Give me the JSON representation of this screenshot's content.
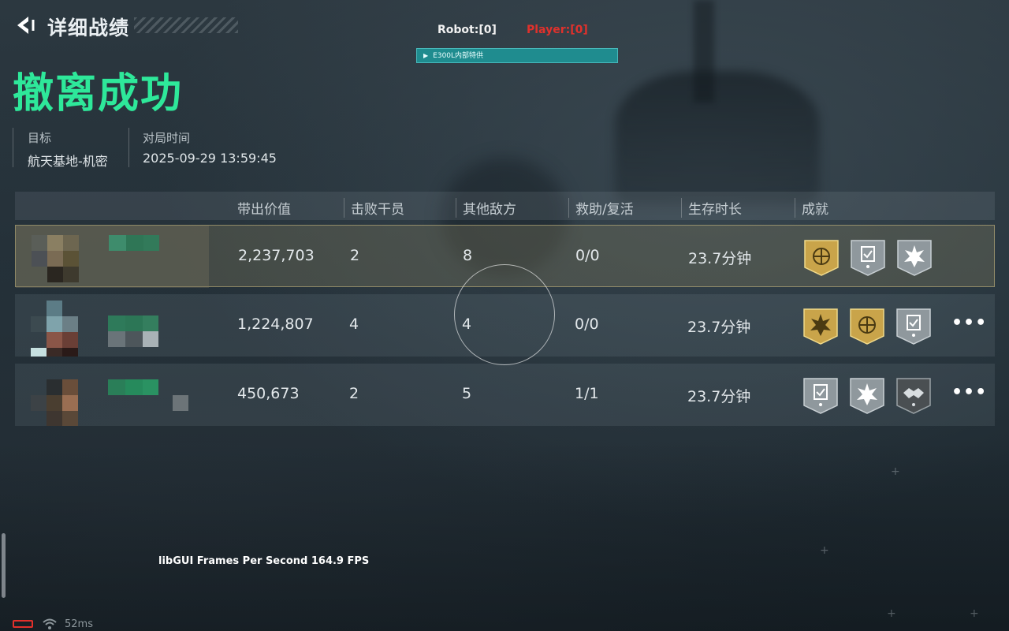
{
  "header": {
    "title": "详细战绩"
  },
  "hud": {
    "robot": "Robot:[0]",
    "player": "Player:[0]",
    "banner": "E300L内部特供"
  },
  "result": "撤离成功",
  "info": {
    "target_label": "目标",
    "target_value": "航天基地-机密",
    "time_label": "对局时间",
    "time_value": "2025-09-29 13:59:45"
  },
  "table": {
    "headers": [
      "带出价值",
      "击败干员",
      "其他敌方",
      "救助/复活",
      "生存时长",
      "成就"
    ],
    "rows": [
      {
        "value": "2,237,703",
        "kills": "2",
        "others": "8",
        "rescue": "0/0",
        "survival": "23.7分钟",
        "badges": [
          "gold-emblem-badge",
          "silver-clipboard-badge",
          "silver-burst-badge"
        ],
        "more": ""
      },
      {
        "value": "1,224,807",
        "kills": "4",
        "others": "4",
        "rescue": "0/0",
        "survival": "23.7分钟",
        "badges": [
          "gold-burst-badge",
          "gold-emblem-badge",
          "silver-clipboard-badge"
        ],
        "more": "•••"
      },
      {
        "value": "450,673",
        "kills": "2",
        "others": "5",
        "rescue": "1/1",
        "survival": "23.7分钟",
        "badges": [
          "silver-clipboard-badge",
          "silver-burst-badge",
          "dark-handshake-badge"
        ],
        "more": "•••"
      }
    ]
  },
  "overlay": {
    "fps": "libGUI Frames Per Second  164.9 FPS",
    "latency": "52ms"
  },
  "colors": {
    "result_green": "#2ee89a",
    "player_red": "#e0312c",
    "banner_teal": "#1f8c8f",
    "gold_badge": "#c9a44a",
    "silver_badge": "#9aa3a8"
  }
}
